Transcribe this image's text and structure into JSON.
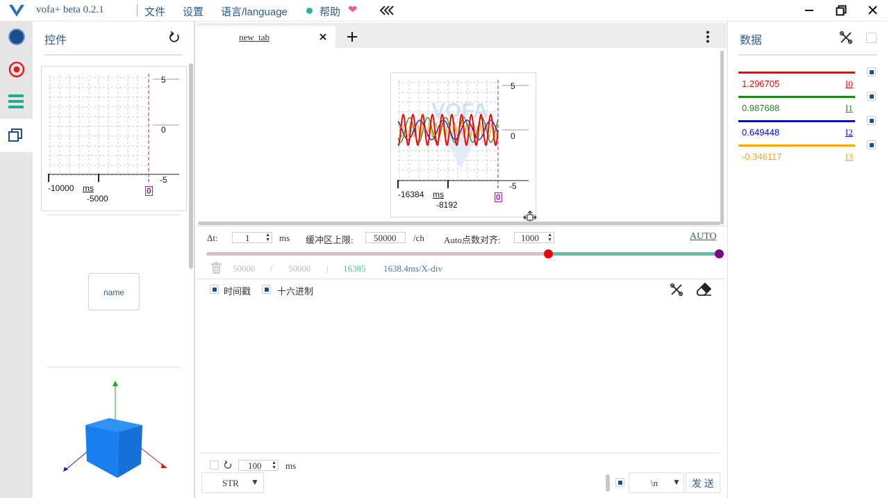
{
  "app": {
    "title": "vofa+ beta 0.2.1",
    "menu": {
      "file": "文件",
      "settings": "设置",
      "language": "语言/language",
      "help": "帮助"
    },
    "window_controls": [
      "minimize",
      "restore",
      "close"
    ]
  },
  "left_panel": {
    "title": "控件",
    "mini_plot": {
      "y_ticks": [
        "5",
        "0",
        "-5"
      ],
      "x_ticks": [
        "-10000",
        "-5000"
      ],
      "x_unit": "ms",
      "cursor": "0"
    },
    "name_button": "name"
  },
  "tabs": [
    {
      "label": "new_tab",
      "active": true
    }
  ],
  "main_plot": {
    "y_ticks": [
      "5",
      "0",
      "-5"
    ],
    "x_ticks": [
      "-16384",
      "-8192"
    ],
    "x_unit": "ms",
    "cursor": "0",
    "watermark": "VOFA"
  },
  "controls": {
    "dt_label": "Δt:",
    "dt_value": "1",
    "dt_unit": "ms",
    "buffer_label": "缓冲区上限:",
    "buffer_value": "50000",
    "buffer_unit": "/ch",
    "auto_align_label": "Auto点数对齐:",
    "auto_align_value": "1000",
    "auto_button": "AUTO",
    "range_start_fraction": 0.666,
    "range_end_fraction": 1.0,
    "stat_count": "50000",
    "stat_sep1": "/",
    "stat_total": "50000",
    "stat_sep2": "|",
    "stat_points": "16385",
    "stat_div": "1638.4ms/X-div"
  },
  "receive": {
    "timestamp_label": "时间戳",
    "hex_label": "十六进制"
  },
  "send": {
    "interval_value": "100",
    "interval_unit": "ms",
    "format": "STR",
    "line_ending": "\\n",
    "send_button": "发 送"
  },
  "right_panel": {
    "title": "数据",
    "channels": [
      {
        "value": "1.296705",
        "name": "I0",
        "color": "#ff0000"
      },
      {
        "value": "0.987688",
        "name": "I1",
        "color": "#1a8a1a"
      },
      {
        "value": "0.649448",
        "name": "I2",
        "color": "#0000ff"
      },
      {
        "value": "-0.346117",
        "name": "I3",
        "color": "#ffa500"
      }
    ]
  }
}
